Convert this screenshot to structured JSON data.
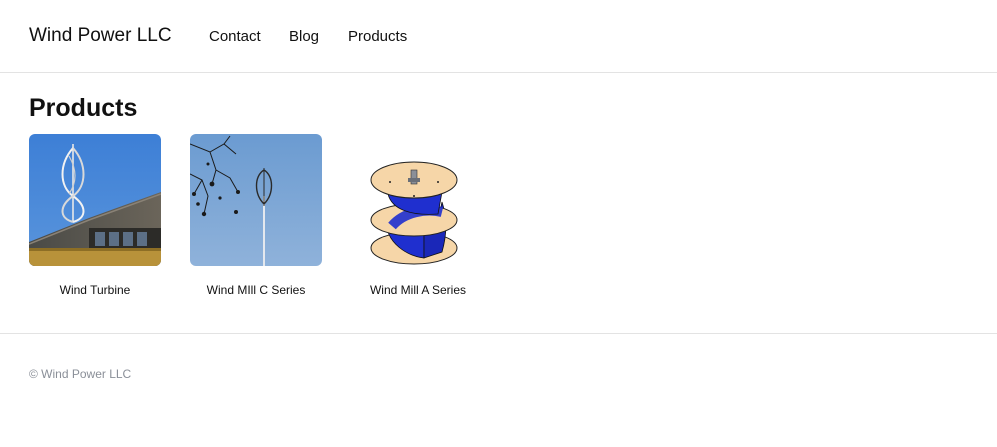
{
  "header": {
    "brand": "Wind Power LLC",
    "nav": [
      "Contact",
      "Blog",
      "Products"
    ]
  },
  "main": {
    "title": "Products",
    "products": [
      {
        "name": "Wind Turbine",
        "image": "wind-turbine-photo"
      },
      {
        "name": "Wind MIll C Series",
        "image": "wind-mill-c-series-photo"
      },
      {
        "name": "Wind Mill A Series",
        "image": "wind-mill-a-series-drawing"
      }
    ]
  },
  "footer": {
    "copyright": "© Wind Power LLC"
  }
}
